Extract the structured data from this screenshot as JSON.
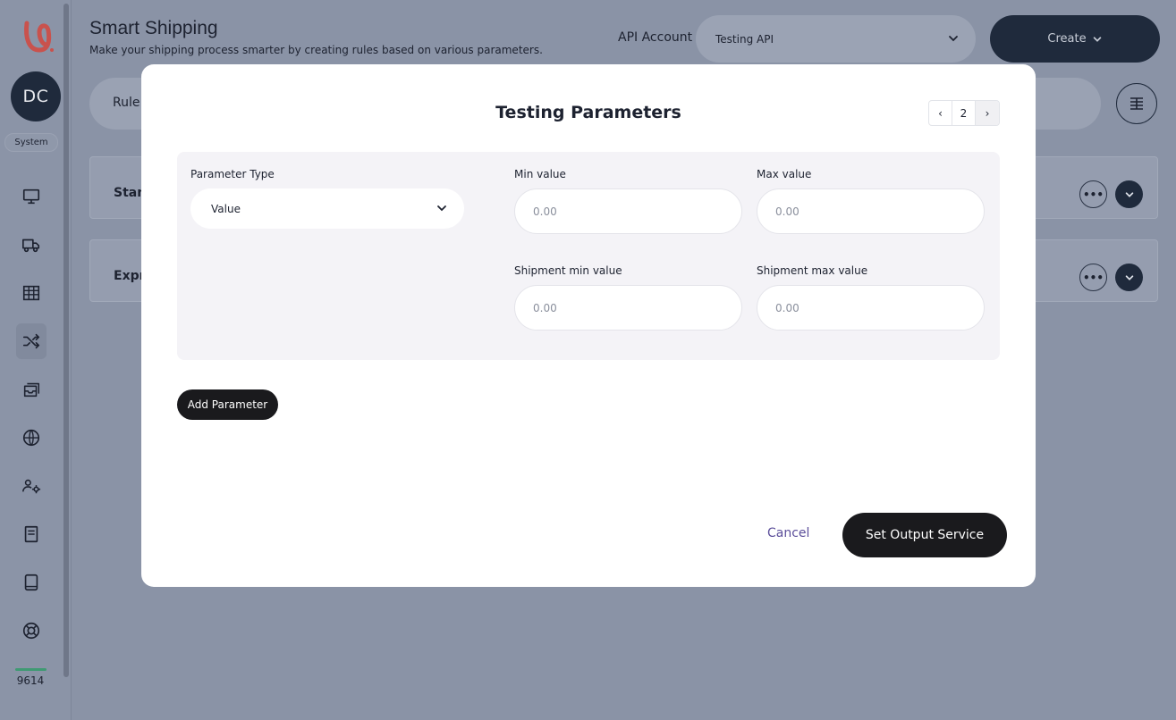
{
  "app": {
    "user_initials": "DC",
    "role": "System",
    "credits": "9614",
    "brand_color": "#d9534f",
    "nav": [
      {
        "icon": "monitor-icon"
      },
      {
        "icon": "truck-icon"
      },
      {
        "icon": "table-icon"
      },
      {
        "icon": "shuffle-icon",
        "active": true
      },
      {
        "icon": "inbox-stack-icon"
      },
      {
        "icon": "globe-icon"
      },
      {
        "icon": "users-gear-icon"
      },
      {
        "icon": "book-icon"
      },
      {
        "icon": "tablet-icon"
      },
      {
        "icon": "lifebuoy-icon"
      }
    ]
  },
  "header": {
    "title": "Smart Shipping",
    "subtitle": "Make your shipping process smarter by creating rules based on various parameters.",
    "api_account_label": "API Account",
    "api_account_value": "Testing API",
    "create_label": "Create"
  },
  "background": {
    "rule_bar_label": "Rule",
    "cards": [
      {
        "label": "Stan"
      },
      {
        "label": "Expr"
      }
    ],
    "more_glyph": "•••"
  },
  "modal": {
    "title": "Testing Parameters",
    "pager": {
      "prev": "‹",
      "page": "2",
      "next": "›"
    },
    "parameter_type_label": "Parameter Type",
    "parameter_type_value": "Value",
    "min_value_label": "Min value",
    "min_value_placeholder": "0.00",
    "max_value_label": "Max value",
    "max_value_placeholder": "0.00",
    "shipment_min_label": "Shipment min value",
    "shipment_min_placeholder": "0.00",
    "shipment_max_label": "Shipment max value",
    "shipment_max_placeholder": "0.00",
    "add_parameter_label": "Add Parameter",
    "cancel_label": "Cancel",
    "submit_label": "Set Output Service",
    "accent_color": "#5b4e9a"
  }
}
